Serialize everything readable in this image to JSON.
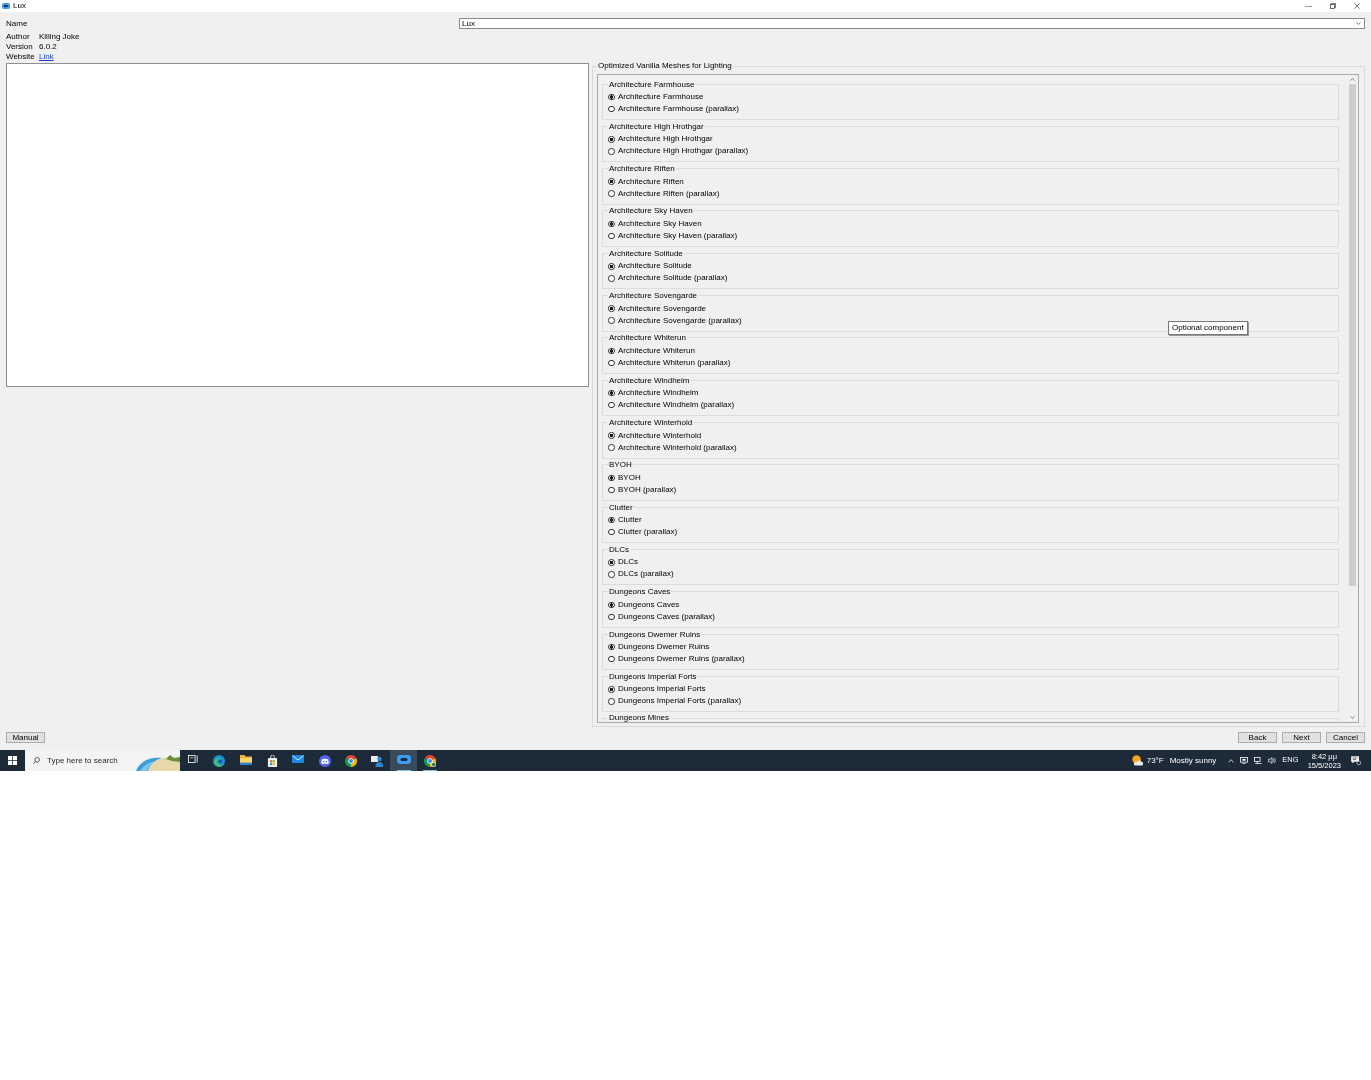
{
  "window": {
    "title": "Lux"
  },
  "name_field": {
    "label": "Name",
    "value": "Lux"
  },
  "details": [
    {
      "label": "Author",
      "value": "Killing Joke",
      "kind": "text"
    },
    {
      "label": "Version",
      "value": "6.0.2",
      "kind": "text"
    },
    {
      "label": "Website",
      "value": "Link",
      "kind": "link"
    }
  ],
  "options_panel": {
    "title": "Optimized Vanilla Meshes for Lighting",
    "groups": [
      {
        "title": "Architecture Farmhouse",
        "options": [
          {
            "label": "Architecture Farmhouse",
            "selected": true
          },
          {
            "label": "Architecture Farmhouse (parallax)",
            "selected": false
          }
        ]
      },
      {
        "title": "Architecture High Hrothgar",
        "options": [
          {
            "label": "Architecture High Hrothgar",
            "selected": true
          },
          {
            "label": "Architecture High Hrothgar (parallax)",
            "selected": false
          }
        ]
      },
      {
        "title": "Architecture Riften",
        "options": [
          {
            "label": "Architecture Riften",
            "selected": true
          },
          {
            "label": "Architecture Riften (parallax)",
            "selected": false
          }
        ]
      },
      {
        "title": "Architecture Sky Haven",
        "options": [
          {
            "label": "Architecture Sky Haven",
            "selected": true
          },
          {
            "label": "Architecture Sky Haven (parallax)",
            "selected": false
          }
        ]
      },
      {
        "title": "Architecture Solitude",
        "options": [
          {
            "label": "Architecture Solitude",
            "selected": true
          },
          {
            "label": "Architecture Solitude (parallax)",
            "selected": false
          }
        ]
      },
      {
        "title": "Architecture Sovengarde",
        "options": [
          {
            "label": "Architecture Sovengarde",
            "selected": true
          },
          {
            "label": "Architecture Sovengarde (parallax)",
            "selected": false
          }
        ]
      },
      {
        "title": "Architecture Whiterun",
        "options": [
          {
            "label": "Architecture Whiterun",
            "selected": true
          },
          {
            "label": "Architecture Whiterun (parallax)",
            "selected": false
          }
        ]
      },
      {
        "title": "Architecture Windhelm",
        "options": [
          {
            "label": "Architecture Windhelm",
            "selected": true
          },
          {
            "label": "Architecture Windhelm (parallax)",
            "selected": false
          }
        ]
      },
      {
        "title": "Architecture Winterhold",
        "options": [
          {
            "label": "Architecture Winterhold",
            "selected": true
          },
          {
            "label": "Architecture Winterhold (parallax)",
            "selected": false
          }
        ]
      },
      {
        "title": "BYOH",
        "options": [
          {
            "label": "BYOH",
            "selected": true
          },
          {
            "label": "BYOH (parallax)",
            "selected": false
          }
        ]
      },
      {
        "title": "Clutter",
        "options": [
          {
            "label": "Clutter",
            "selected": true
          },
          {
            "label": "Clutter (parallax)",
            "selected": false
          }
        ]
      },
      {
        "title": "DLCs",
        "options": [
          {
            "label": "DLCs",
            "selected": true
          },
          {
            "label": "DLCs (parallax)",
            "selected": false
          }
        ]
      },
      {
        "title": "Dungeons Caves",
        "options": [
          {
            "label": "Dungeons Caves",
            "selected": true
          },
          {
            "label": "Dungeons Caves (parallax)",
            "selected": false
          }
        ]
      },
      {
        "title": "Dungeons Dwemer Ruins",
        "options": [
          {
            "label": "Dungeons Dwemer Ruins",
            "selected": true
          },
          {
            "label": "Dungeons Dwemer Ruins (parallax)",
            "selected": false
          }
        ]
      },
      {
        "title": "Dungeons Imperial Forts",
        "options": [
          {
            "label": "Dungeons Imperial Forts",
            "selected": true
          },
          {
            "label": "Dungeons Imperial Forts (parallax)",
            "selected": false
          }
        ]
      },
      {
        "title": "Dungeons Mines"
      }
    ],
    "tooltip": "Optional component"
  },
  "footer": {
    "left_buttons": [
      "Manual"
    ],
    "right_buttons": [
      "Back",
      "Next",
      "Cancel"
    ]
  },
  "taskbar": {
    "search_placeholder": "Type here to search",
    "apps": [
      {
        "kind": "taskview",
        "selected": false,
        "running": false
      },
      {
        "kind": "swirl",
        "selected": false,
        "running": false
      },
      {
        "kind": "folder",
        "selected": false,
        "running": false
      },
      {
        "kind": "bag",
        "selected": false,
        "running": false
      },
      {
        "kind": "envelope",
        "selected": false,
        "running": false
      },
      {
        "kind": "chat",
        "selected": false,
        "running": false
      },
      {
        "kind": "ball",
        "selected": false,
        "running": false
      },
      {
        "kind": "figure",
        "selected": false,
        "running": false
      },
      {
        "kind": "capsule",
        "selected": true,
        "running": true
      },
      {
        "kind": "ballbadge",
        "selected": false,
        "running": true
      }
    ],
    "weather": {
      "temperature": "73°F",
      "condition": "Mostly sunny"
    },
    "language": "ENG",
    "time": "8:42 μμ",
    "date": "15/5/2023"
  }
}
